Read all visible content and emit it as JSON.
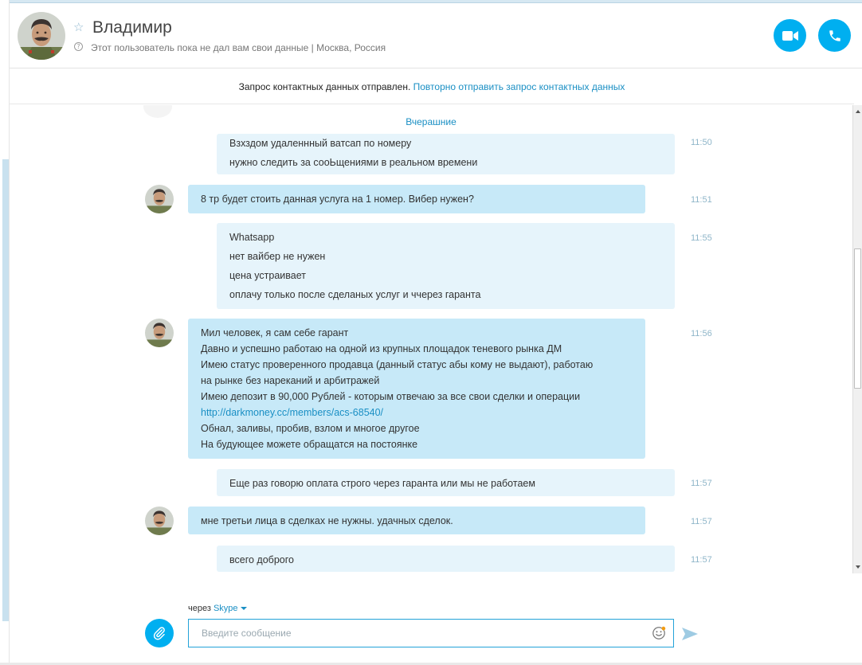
{
  "header": {
    "contact_name": "Владимир",
    "status": "Этот пользователь пока не дал вам свои данные  |  Москва, Россия"
  },
  "notice": {
    "text": "Запрос контактных данных отправлен.",
    "link": "Повторно отправить запрос контактных данных"
  },
  "chat": {
    "day_separator": "Вчерашние",
    "messages": [
      {
        "lines": [
          "Взхздом удаленнный ватсап по номеру",
          "нужно следить за сооЬщениями в реальном времени"
        ],
        "time": "11:50"
      },
      {
        "lines": [
          "8 тр будет стоить данная услуга на 1 номер. Вибер нужен?"
        ],
        "time": "11:51"
      },
      {
        "lines": [
          "Whatsapp",
          "нет вайбер не нужен",
          "цена устраивает",
          "оплачу только после сделаных услуг и ччерез гаранта"
        ],
        "time": "11:55"
      },
      {
        "lines": [
          "Мил человек, я сам себе гарант",
          "Давно и успешно работаю на одной из крупных площадок теневого рынка ДМ",
          "Имею статус проверенного продавца (данный статус абы кому не выдают), работаю",
          "на рынке без нареканий и арбитражей",
          "Имею депозит в 90,000 Рублей - которым отвечаю за все свои сделки и операции",
          "http://darkmoney.cc/members/acs-68540/",
          "Обнал, заливы, пробив, взлом и многое другое",
          "На будующее можете обращатся на постоянке"
        ],
        "time": "11:56"
      },
      {
        "lines": [
          "Еще раз говорю оплата строго через гаранта или мы не работаем"
        ],
        "time": "11:57"
      },
      {
        "lines": [
          "мне третьи лица в сделках не нужны. удачных сделок."
        ],
        "time": "11:57"
      },
      {
        "lines": [
          "всего доброго"
        ],
        "time": "11:57"
      }
    ]
  },
  "composer": {
    "via_label": "через",
    "via_service": "Skype",
    "placeholder": "Введите сообщение"
  },
  "colors": {
    "accent": "#00aff0",
    "link": "#1a8fc4",
    "incoming_bubble": "#c7e9f8",
    "outgoing_bubble": "#e6f4fb"
  },
  "icons": [
    "star-icon",
    "help-icon",
    "video-call-icon",
    "phone-icon",
    "attach-icon",
    "emoji-icon",
    "send-icon"
  ]
}
